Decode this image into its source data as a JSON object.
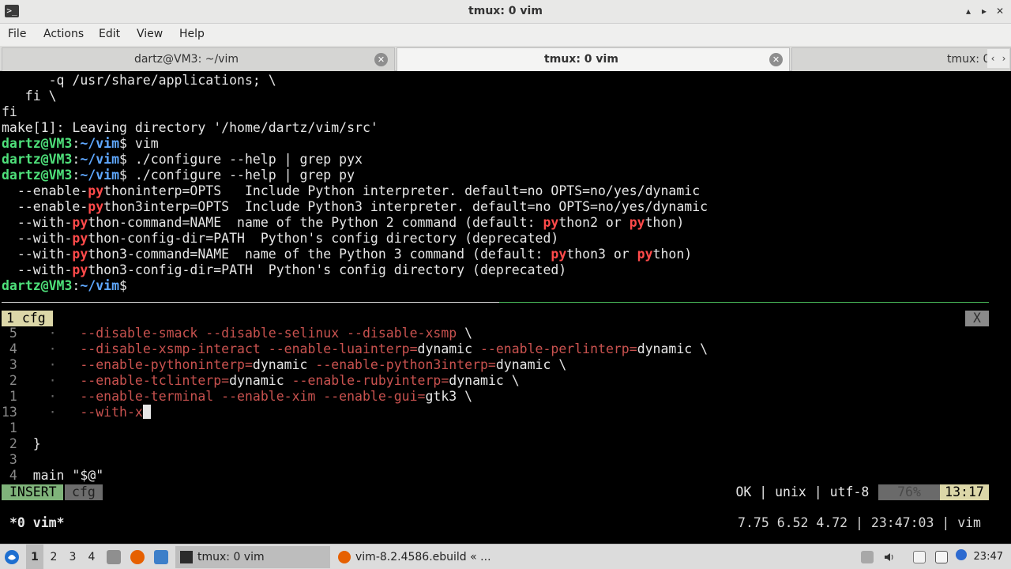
{
  "window": {
    "title": "tmux: 0 vim",
    "minimize": "▴",
    "maximize": "▸",
    "close": "✕",
    "app_icon": ">_"
  },
  "menu": {
    "items": [
      "File",
      "Actions",
      "Edit",
      "View",
      "Help"
    ]
  },
  "tabs": [
    {
      "label": "dartz@VM3: ~/vim",
      "active": false
    },
    {
      "label": "tmux: 0 vim",
      "active": true
    },
    {
      "label": "tmux: 0",
      "active": false
    }
  ],
  "tab_close_glyph": "✕",
  "tab_scroll": {
    "left": "‹",
    "right": "›"
  },
  "terminal": {
    "prompt_user": "dartz@VM3",
    "prompt_path": "~/vim",
    "shell_lines": [
      "      -q /usr/share/applications; \\",
      "   fi \\",
      "fi",
      "make[1]: Leaving directory '/home/dartz/vim/src'"
    ],
    "commands": [
      "vim",
      "./configure --help | grep pyx",
      "./configure --help | grep py"
    ],
    "grep_output": [
      {
        "pre": "  --enable-",
        "hl": "py",
        "post": "thoninterp=OPTS   Include Python interpreter. default=no OPTS=no/yes/dynamic"
      },
      {
        "pre": "  --enable-",
        "hl": "py",
        "post": "thon3interp=OPTS  Include Python3 interpreter. default=no OPTS=no/yes/dynamic"
      },
      {
        "pre": "  --with-",
        "hl": "py",
        "post": "thon-command=NAME  name of the Python 2 command (default: ",
        "hl2": "py",
        "mid": "thon2 or ",
        "hl3": "py",
        "end": "thon)"
      },
      {
        "pre": "  --with-",
        "hl": "py",
        "post": "thon-config-dir=PATH  Python's config directory (deprecated)"
      },
      {
        "pre": "  --with-",
        "hl": "py",
        "post": "thon3-command=NAME  name of the Python 3 command (default: ",
        "hl2": "py",
        "mid": "thon3 or ",
        "hl3": "py",
        "end": "thon)"
      },
      {
        "pre": "  --with-",
        "hl": "py",
        "post": "thon3-config-dir=PATH  Python's config directory (deprecated)"
      }
    ],
    "prompt_symbol": "$"
  },
  "vim": {
    "tab_label": "1 cfg",
    "tab_close": "X",
    "lines": [
      {
        "num": "5",
        "text": [
          [
            "opt",
            "--disable-smack --disable-selinux --disable-xsmp"
          ],
          [
            "txt",
            " \\"
          ]
        ]
      },
      {
        "num": "4",
        "text": [
          [
            "opt",
            "--disable-xsmp-interact --enable-luainterp="
          ],
          [
            "txt",
            "dynamic "
          ],
          [
            "opt",
            "--enable-perlinterp="
          ],
          [
            "txt",
            "dynamic \\"
          ]
        ]
      },
      {
        "num": "3",
        "text": [
          [
            "opt",
            "--enable-pythoninterp="
          ],
          [
            "txt",
            "dynamic "
          ],
          [
            "opt",
            "--enable-python3interp="
          ],
          [
            "txt",
            "dynamic \\"
          ]
        ]
      },
      {
        "num": "2",
        "text": [
          [
            "opt",
            "--enable-tclinterp="
          ],
          [
            "txt",
            "dynamic "
          ],
          [
            "opt",
            "--enable-rubyinterp="
          ],
          [
            "txt",
            "dynamic \\"
          ]
        ]
      },
      {
        "num": "1",
        "text": [
          [
            "opt",
            "--enable-terminal --enable-xim --enable-gui="
          ],
          [
            "txt",
            "gtk3 \\"
          ]
        ]
      },
      {
        "num": "13",
        "text": [
          [
            "opt",
            "--with-x"
          ]
        ]
      },
      {
        "num": "1",
        "text": []
      },
      {
        "num": "2",
        "text": [
          [
            "txt",
            "}"
          ]
        ]
      },
      {
        "num": "3",
        "text": []
      },
      {
        "num": "4",
        "text": [
          [
            "txt",
            "main \"$@\""
          ]
        ]
      }
    ],
    "indent_dot": "·",
    "mode": "INSERT",
    "filetype": "cfg",
    "status_right": "OK | unix | utf-8 | sh",
    "percent": "76%",
    "position": "13:17"
  },
  "tmux": {
    "left": "*0 vim*",
    "right": "7.75 6.52 4.72 | 23:47:03 | vim"
  },
  "taskbar": {
    "workspaces": [
      "1",
      "2",
      "3",
      "4"
    ],
    "tasks": [
      "tmux: 0 vim",
      "vim-8.2.4586.ebuild « ..."
    ],
    "clock": "23:47",
    "colors": {
      "browser": "#e66000",
      "files": "#8f8f8f",
      "desktop": "#3d7fc9",
      "terminal": "#2b2b2b"
    }
  }
}
